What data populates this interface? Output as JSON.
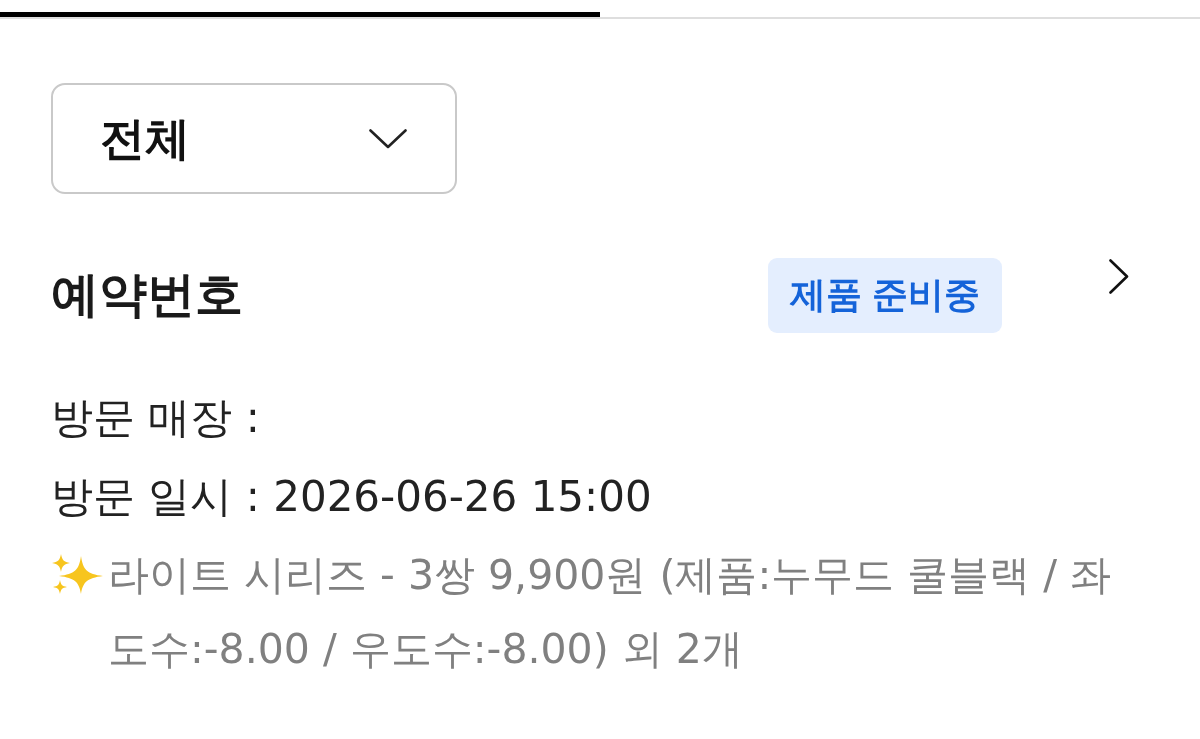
{
  "progress": {
    "level": 0.5
  },
  "filter": {
    "value": "전체"
  },
  "reservation": {
    "title": "예약번호",
    "status": "제품 준비중",
    "details": [
      "방문 매장 :",
      "방문 일시 : 2026-06-26 15:00"
    ],
    "items_summary": "라이트 시리즈 - 3쌍 9,900원 (제품:누무드 쿨블랙 / 좌도수:-8.00 / 우도수:-8.00) 외 2개"
  }
}
